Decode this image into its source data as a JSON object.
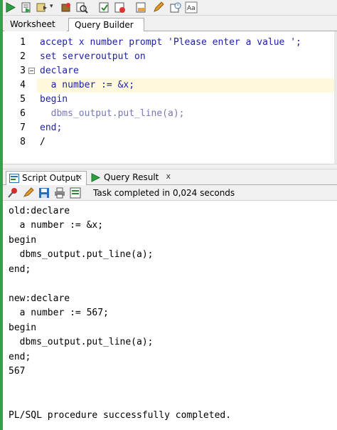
{
  "toolbar": {
    "buttons": [
      "run-statement",
      "run-script",
      "commit",
      "rollback",
      "autotrace",
      "explain-plan",
      "clear",
      "sql-tuning",
      "history",
      "format",
      "find-replace"
    ]
  },
  "worksheet_tabs": [
    {
      "label": "Worksheet",
      "active": true
    },
    {
      "label": "Query Builder",
      "active": false
    }
  ],
  "editor": {
    "line_numbers": [
      "1",
      "2",
      "3",
      "4",
      "5",
      "6",
      "7",
      "8"
    ],
    "lines": [
      "accept x number prompt 'Please enter a value ';",
      "set serveroutput on",
      "declare",
      "  a number := &x;",
      "begin",
      "  dbms_output.put_line(a);",
      "end;",
      "/"
    ],
    "current_line": 4
  },
  "output_tabs": [
    {
      "label": "Script Output",
      "close": "x",
      "active": true
    },
    {
      "label": "Query Result",
      "close": "x",
      "active": false
    }
  ],
  "output_toolbar": {
    "status": "Task completed in 0,024 seconds"
  },
  "output_lines": [
    "old:declare",
    "  a number := &x;",
    "begin",
    "  dbms_output.put_line(a);",
    "end;",
    "",
    "new:declare",
    "  a number := 567;",
    "begin",
    "  dbms_output.put_line(a);",
    "end;",
    "567",
    "",
    "",
    "PL/SQL procedure successfully completed."
  ],
  "colors": {
    "keyword": "#1e1ea8",
    "builtin_call": "#7777b8",
    "current_line_highlight": "#fef8dc",
    "left_accent": "#31a14a"
  }
}
